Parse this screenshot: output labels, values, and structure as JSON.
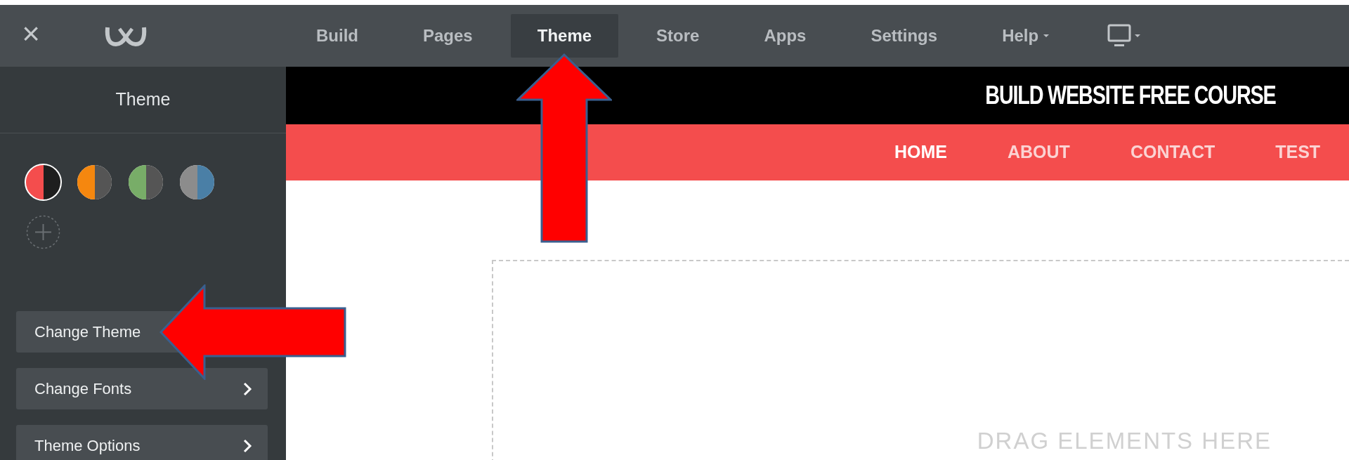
{
  "topbar": {
    "close": "×",
    "tabs": [
      {
        "label": "Build",
        "selected": false,
        "caret": false,
        "arrow": false
      },
      {
        "label": "Pages",
        "selected": false,
        "caret": false,
        "arrow": false
      },
      {
        "label": "Theme",
        "selected": true,
        "caret": false,
        "arrow": true
      },
      {
        "label": "Store",
        "selected": false,
        "caret": false,
        "arrow": false
      },
      {
        "label": "Apps",
        "selected": false,
        "caret": false,
        "arrow": false
      },
      {
        "label": "Settings",
        "selected": false,
        "caret": false,
        "arrow": false
      },
      {
        "label": "Help",
        "selected": false,
        "caret": true,
        "arrow": false
      }
    ]
  },
  "sidebar": {
    "title": "Theme",
    "swatches": [
      {
        "halves": [
          {
            "color": "#f44d4d"
          },
          {
            "color": "#1e1e1e"
          }
        ],
        "selected": true
      },
      {
        "halves": [
          {
            "color": "#f5870f"
          },
          {
            "color": "#555555"
          }
        ],
        "selected": false
      },
      {
        "halves": [
          {
            "color": "#78ad68"
          },
          {
            "color": "#555555"
          }
        ],
        "selected": false
      },
      {
        "halves": [
          {
            "color": "#8c8c8c"
          },
          {
            "color": "#4a7fa6"
          }
        ],
        "selected": false
      }
    ],
    "buttons": [
      {
        "label": "Change Theme",
        "chevron": false,
        "arrow": true
      },
      {
        "label": "Change Fonts",
        "chevron": true,
        "arrow": false
      },
      {
        "label": "Theme Options",
        "chevron": true,
        "arrow": false
      }
    ]
  },
  "site": {
    "title": "BUILD WEBSITE FREE COURSE",
    "nav": [
      {
        "label": "HOME",
        "selected": true
      },
      {
        "label": "ABOUT",
        "selected": false
      },
      {
        "label": "CONTACT",
        "selected": false
      },
      {
        "label": "TEST",
        "selected": false
      }
    ],
    "drop_zone": "DRAG ELEMENTS HERE"
  }
}
